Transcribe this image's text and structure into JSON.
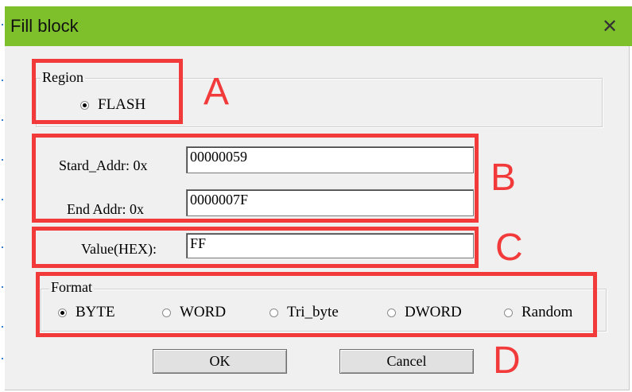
{
  "dialog": {
    "title": "Fill block",
    "close_icon": "close-icon"
  },
  "region": {
    "label": "Region",
    "options": [
      {
        "label": "FLASH",
        "selected": true
      }
    ]
  },
  "address": {
    "start_label": "Stard_Addr: 0x",
    "start_value": "00000059",
    "end_label": "End  Addr: 0x",
    "end_value": "0000007F"
  },
  "value": {
    "label": "Value(HEX):",
    "value": "FF"
  },
  "format": {
    "label": "Format",
    "options": [
      {
        "label": "BYTE",
        "selected": true
      },
      {
        "label": "WORD",
        "selected": false
      },
      {
        "label": "Tri_byte",
        "selected": false
      },
      {
        "label": "DWORD",
        "selected": false
      },
      {
        "label": "Random",
        "selected": false
      }
    ]
  },
  "buttons": {
    "ok": "OK",
    "cancel": "Cancel"
  },
  "annotations": {
    "a": "A",
    "b": "B",
    "c": "C",
    "d": "D",
    "color": "#f23a3a"
  },
  "colors": {
    "titlebar": "#7ec02c",
    "client": "#f0f0f0"
  }
}
